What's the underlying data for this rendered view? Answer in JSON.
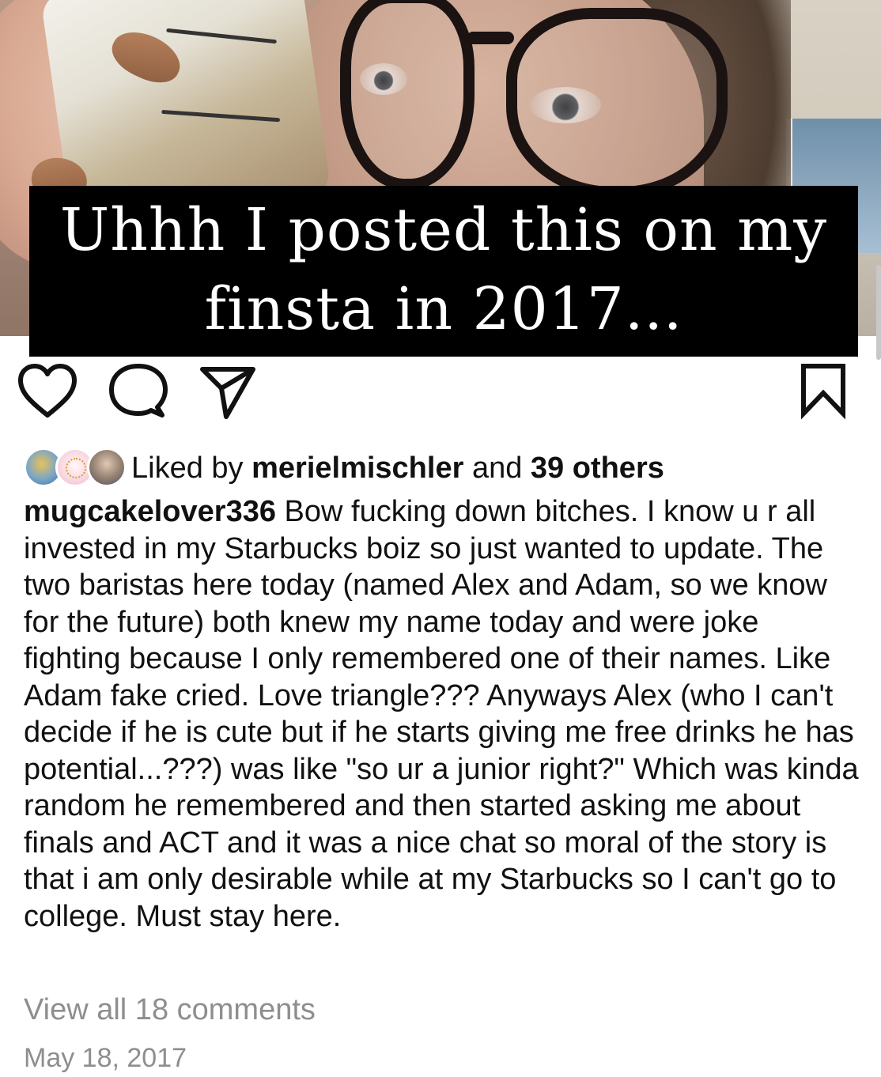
{
  "post": {
    "overlay_text": "Uhhh I posted this on my finsta in 2017...",
    "likes": {
      "prefix": "Liked by",
      "liker": "merielmischler",
      "middle": "and",
      "others": "39 others"
    },
    "caption": {
      "username": "mugcakelover336",
      "text": "Bow fucking down bitches. I know u r all invested in my Starbucks boiz so just wanted to update. The two baristas here today (named Alex and Adam, so we know for the future) both knew my name today and were joke fighting because I only remembered one of their names. Like Adam fake cried. Love triangle??? Anyways Alex (who I can't decide if he is cute but if he starts giving me free drinks he has potential...???) was like \"so ur a junior right?\" Which was kinda random he remembered and then started asking me about finals and ACT and it was a nice chat so moral of the story is that i am only desirable while at my Starbucks so I can't go to college. Must stay here."
    },
    "view_comments": "View all 18 comments",
    "date": "May 18, 2017"
  },
  "icons": {
    "like": "heart-icon",
    "comment": "comment-bubble-icon",
    "share": "paper-plane-icon",
    "save": "bookmark-icon"
  }
}
